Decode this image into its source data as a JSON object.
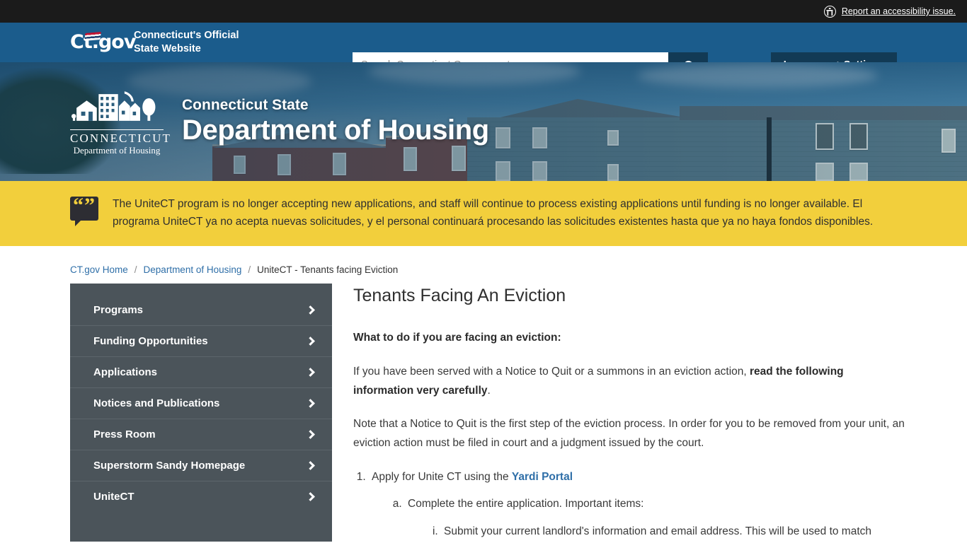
{
  "topbar": {
    "accessibility_link": "Report an accessibility issue.",
    "accessibility_icon": "accessibility-icon"
  },
  "masthead": {
    "logo_wordmark": "Ct.gov",
    "brand_line1": "Connecticut's Official",
    "brand_line2": "State Website",
    "search_placeholder": "Search Connecticut Government...",
    "search_value": "",
    "search_icon": "search-icon",
    "language_settings_label": "Language + Settings"
  },
  "hero": {
    "logo_state": "CONNECTICUT",
    "logo_sub": "Department of Housing",
    "eyebrow": "Connecticut State",
    "title": "Department of Housing"
  },
  "alert": {
    "icon": "quote-bubble-icon",
    "message": "The UniteCT program is no longer accepting new applications, and staff will continue to process existing applications until funding is no longer available. El programa UniteCT ya no acepta nuevas solicitudes, y el personal continuará procesando las solicitudes existentes hasta que ya no haya fondos disponibles."
  },
  "breadcrumb": {
    "home": "CT.gov Home",
    "parent": "Department of Housing",
    "current": "UniteCT - Tenants facing Eviction",
    "separator": "/"
  },
  "sidebar": {
    "items": [
      {
        "label": "Programs"
      },
      {
        "label": "Funding Opportunities"
      },
      {
        "label": "Applications"
      },
      {
        "label": "Notices and Publications"
      },
      {
        "label": "Press Room"
      },
      {
        "label": "Superstorm Sandy Homepage"
      },
      {
        "label": "UniteCT"
      }
    ]
  },
  "main": {
    "title": "Tenants Facing An Eviction",
    "lead": "What to do if you are facing an eviction:",
    "para1_a": "If you have been served with a Notice to Quit or a summons in an eviction action, ",
    "para1_bold": "read the following information very carefully",
    "para1_b": ".",
    "para2": "Note that a Notice to Quit is the first step of the eviction process.  In order for you to be removed from your unit, an eviction action must be filed in court and a judgment issued by the court.",
    "item1_a": "Apply for Unite CT using the ",
    "item1_link": "Yardi Portal",
    "item1_sub_a": "Complete the entire application. Important items:",
    "item1_sub_a_i": "Submit your current landlord's information and email address. This will be used to match"
  },
  "colors": {
    "topbar": "#1b1b1b",
    "masthead_blue": "#1b5c8c",
    "button_dark_blue": "#123a55",
    "alert_yellow": "#f2cf3c",
    "sidebar_slate": "#4b545a",
    "link_blue": "#2f6fa8"
  }
}
